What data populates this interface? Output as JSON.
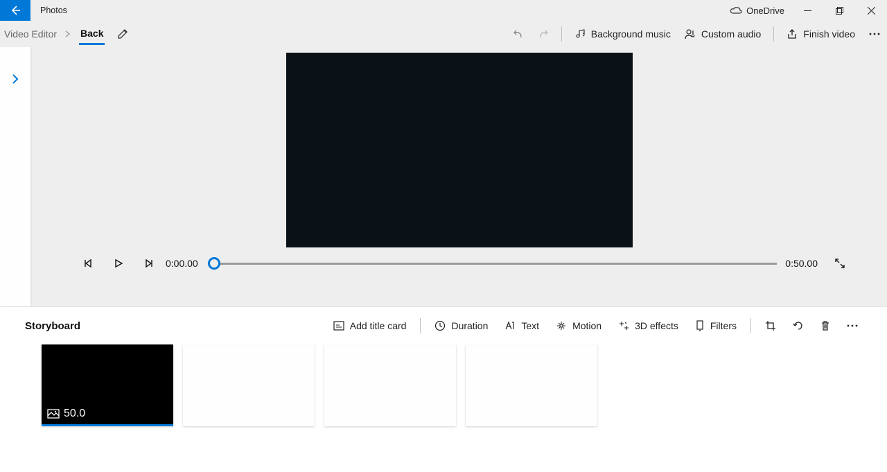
{
  "titlebar": {
    "app_name": "Photos",
    "onedrive_label": "OneDrive"
  },
  "breadcrumb": {
    "root": "Video Editor",
    "current": "Back"
  },
  "toolbar": {
    "bg_music": "Background music",
    "custom_audio": "Custom audio",
    "finish": "Finish video"
  },
  "playback": {
    "current_time": "0:00.00",
    "total_time": "0:50.00"
  },
  "storyboard": {
    "title": "Storyboard",
    "add_title_card": "Add title card",
    "duration": "Duration",
    "text": "Text",
    "motion": "Motion",
    "effects_3d": "3D effects",
    "filters": "Filters",
    "clip_duration": "50.0"
  }
}
